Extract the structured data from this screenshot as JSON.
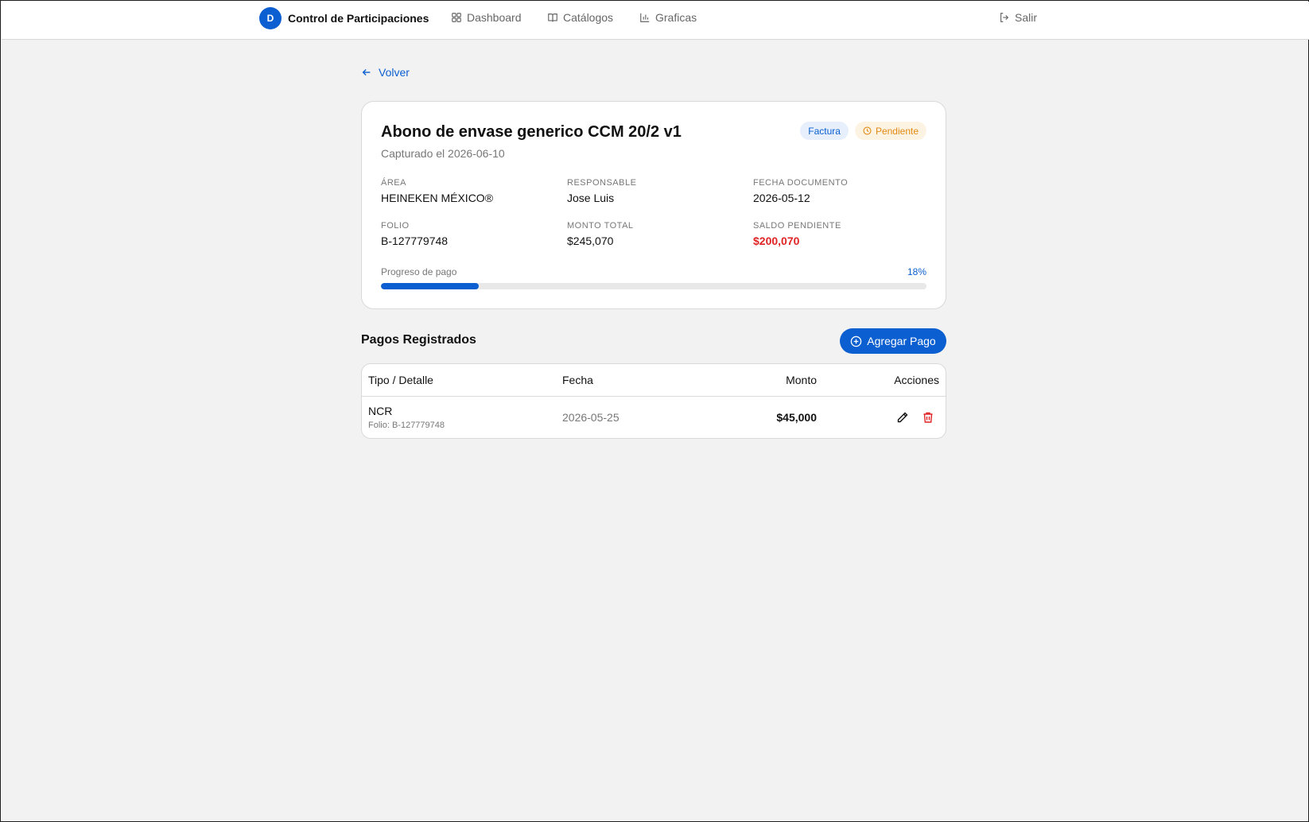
{
  "nav": {
    "brand_initial": "D",
    "brand_title": "Control de Participaciones",
    "links": [
      {
        "label": "Dashboard",
        "icon": "grid-icon"
      },
      {
        "label": "Catálogos",
        "icon": "book-icon"
      },
      {
        "label": "Graficas",
        "icon": "bar-chart-icon"
      }
    ],
    "logout_label": "Salir"
  },
  "back_label": "Volver",
  "record": {
    "title": "Abono de envase generico CCM 20/2 v1",
    "captured": "Capturado el 2026-06-10",
    "type_badge": "Factura",
    "status_badge": "Pendiente",
    "fields": {
      "area": {
        "label": "Área",
        "value": "HEINEKEN MÉXICO®"
      },
      "responsable": {
        "label": "Responsable",
        "value": "Jose Luis"
      },
      "fecha_documento": {
        "label": "Fecha Documento",
        "value": "2026-05-12"
      },
      "folio": {
        "label": "Folio",
        "value": "B-127779748"
      },
      "monto_total": {
        "label": "Monto Total",
        "value": "$245,070"
      },
      "saldo_pendiente": {
        "label": "Saldo Pendiente",
        "value": "$200,070"
      }
    },
    "progress": {
      "label": "Progreso de pago",
      "percent_text": "18%",
      "percent": 18
    }
  },
  "payments": {
    "title": "Pagos Registrados",
    "add_label": "Agregar Pago",
    "columns": [
      "Tipo / Detalle",
      "Fecha",
      "Monto",
      "Acciones"
    ],
    "rows": [
      {
        "tipo": "NCR",
        "detalle": "Folio: B-127779748",
        "fecha": "2026-05-25",
        "monto": "$45,000"
      }
    ]
  },
  "colors": {
    "accent": "#0b5fd0",
    "danger": "#e02424",
    "pending": "#e38a12"
  }
}
